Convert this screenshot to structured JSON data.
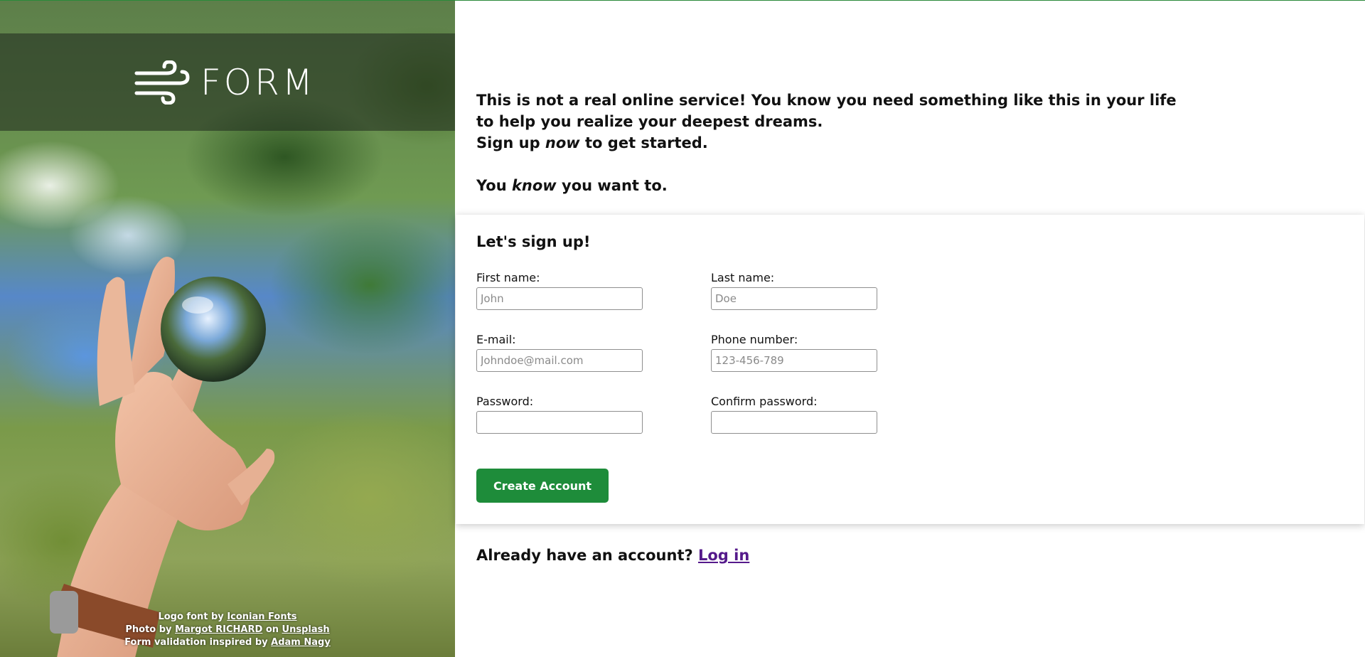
{
  "brand": {
    "logo_text": "FORM",
    "logo_icon": "wind-icon"
  },
  "credits": {
    "line1_prefix": "Logo font by ",
    "line1_link": "Iconian Fonts",
    "line2_prefix": "Photo by ",
    "line2_link1": "Margot RICHARD",
    "line2_middle": " on ",
    "line2_link2": "Unsplash",
    "line3_prefix": "Form validation inspired by ",
    "line3_link": "Adam Nagy"
  },
  "intro": {
    "line1": "This is not a real online service! You know you need something like this in your life",
    "line2": "to help you realize your deepest dreams.",
    "line3_prefix": "Sign up ",
    "line3_emphasis": "now",
    "line3_suffix": " to get started.",
    "line4_prefix": "You ",
    "line4_emphasis": "know",
    "line4_suffix": " you want to."
  },
  "form": {
    "title": "Let's sign up!",
    "fields": {
      "first_name": {
        "label": "First name:",
        "placeholder": "John",
        "value": ""
      },
      "last_name": {
        "label": "Last name:",
        "placeholder": "Doe",
        "value": ""
      },
      "email": {
        "label": "E-mail:",
        "placeholder": "Johndoe@mail.com",
        "value": ""
      },
      "phone": {
        "label": "Phone number:",
        "placeholder": "123-456-789",
        "value": ""
      },
      "password": {
        "label": "Password:",
        "placeholder": "",
        "value": ""
      },
      "confirm_password": {
        "label": "Confirm password:",
        "placeholder": "",
        "value": ""
      }
    },
    "submit_label": "Create Account"
  },
  "login": {
    "prompt": "Already have an account? ",
    "link_label": "Log in"
  },
  "colors": {
    "accent": "#1e8c3a",
    "link_visited": "#551a8b",
    "text": "#111111"
  }
}
